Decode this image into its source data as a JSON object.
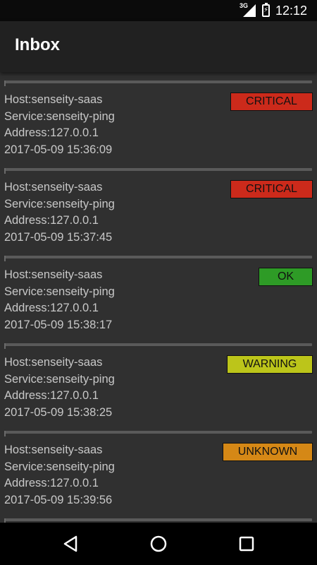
{
  "status_bar": {
    "network_type": "3G",
    "time": "12:12"
  },
  "toolbar": {
    "title": "Inbox"
  },
  "alerts": [
    {
      "host": "Host:senseity-saas",
      "service": "Service:senseity-ping",
      "address": "Address:127.0.0.1",
      "timestamp": "2017-05-09 15:36:09",
      "status": "CRITICAL",
      "color": "#cc2a1b"
    },
    {
      "host": "Host:senseity-saas",
      "service": "Service:senseity-ping",
      "address": "Address:127.0.0.1",
      "timestamp": "2017-05-09 15:37:45",
      "status": "CRITICAL",
      "color": "#cc2a1b"
    },
    {
      "host": "Host:senseity-saas",
      "service": "Service:senseity-ping",
      "address": "Address:127.0.0.1",
      "timestamp": "2017-05-09 15:38:17",
      "status": "OK",
      "color": "#2e9b26"
    },
    {
      "host": "Host:senseity-saas",
      "service": "Service:senseity-ping",
      "address": "Address:127.0.0.1",
      "timestamp": "2017-05-09 15:38:25",
      "status": "WARNING",
      "color": "#bcc51a"
    },
    {
      "host": "Host:senseity-saas",
      "service": "Service:senseity-ping",
      "address": "Address:127.0.0.1",
      "timestamp": "2017-05-09 15:39:56",
      "status": "UNKNOWN",
      "color": "#d58816"
    }
  ],
  "nav_bar": {
    "back_icon": "back-triangle-icon",
    "home_icon": "home-circle-icon",
    "recents_icon": "recents-square-icon"
  }
}
